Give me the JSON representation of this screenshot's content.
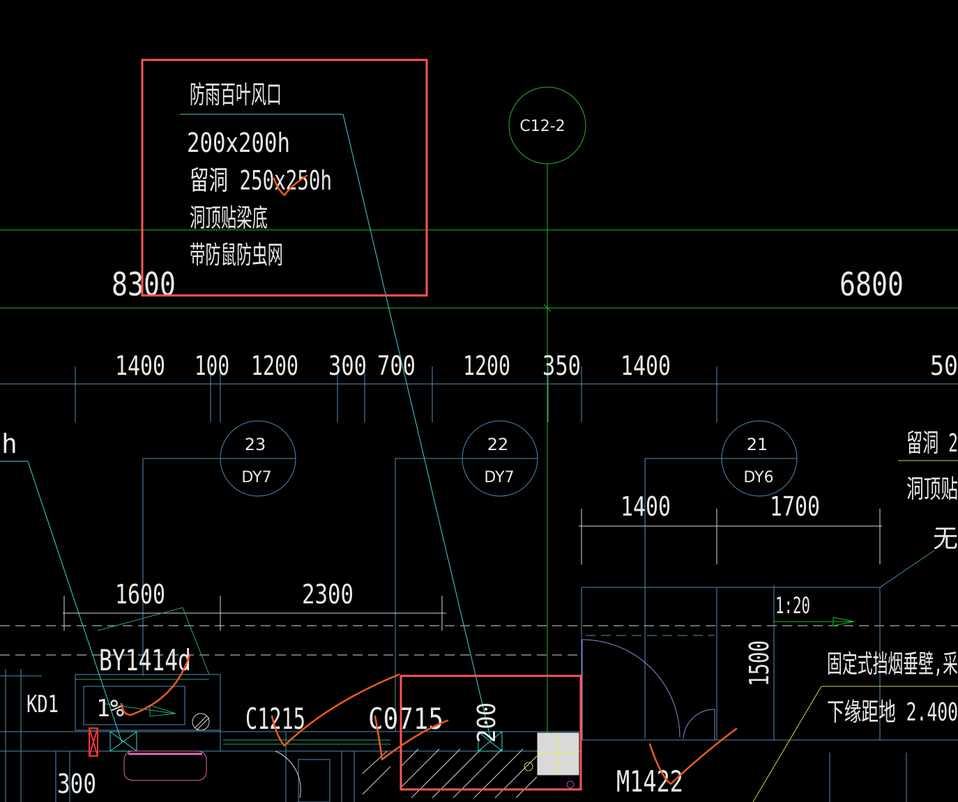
{
  "vent_note": {
    "title": "防雨百叶风口",
    "size": "200x200h",
    "hole": "留洞 250x250h",
    "line3": "洞顶贴梁底",
    "line4": "带防鼠防虫网"
  },
  "big_dims": {
    "left": "8300",
    "right": "6800"
  },
  "top_dims": [
    "1400",
    "100",
    "1200",
    "300",
    "700",
    "1200",
    "350",
    "1400",
    "50"
  ],
  "column_grid": {
    "label": "C12-2"
  },
  "pipe_markers": [
    {
      "num": "23",
      "code": "DY7"
    },
    {
      "num": "22",
      "code": "DY7"
    },
    {
      "num": "21",
      "code": "DY6"
    }
  ],
  "mid_dims": {
    "a": "1400",
    "b": "1700"
  },
  "lower_dims": {
    "a": "1600",
    "b": "2300"
  },
  "right_note": {
    "line1": "留洞 2",
    "line2": "洞顶贴",
    "line3": "无",
    "bracket": "|"
  },
  "slope": "1:20",
  "dim_1500": "1500",
  "dim_200": "200",
  "smoke_note": {
    "line1": "固定式挡烟垂壁,采",
    "line2": "下缘距地 2.400"
  },
  "fragment_h": "h",
  "labels": {
    "by": "BY1414d",
    "kd": "KD1",
    "pct": "1%",
    "c1215": "C1215",
    "c0715": "C0715",
    "m1422": "M1422",
    "d300": "300"
  },
  "colors": {
    "background": "#000000",
    "highlight_box": "#ff5555",
    "markup_stroke": "#f05a1e",
    "leader_line": "#3fd6d6",
    "grid_line": "#22bb22",
    "wall_line": "#4f8fb8"
  }
}
